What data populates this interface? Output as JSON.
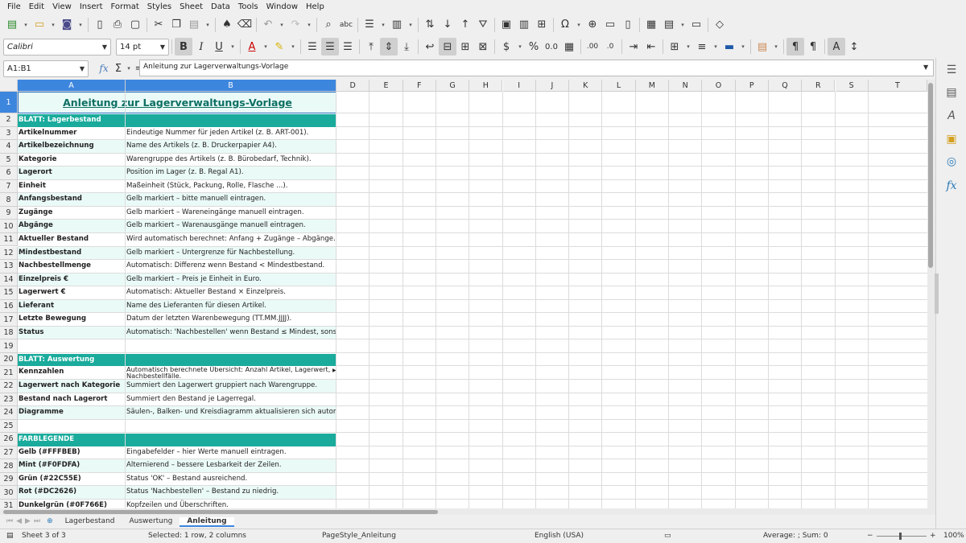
{
  "menu": [
    "File",
    "Edit",
    "View",
    "Insert",
    "Format",
    "Styles",
    "Sheet",
    "Data",
    "Tools",
    "Window",
    "Help"
  ],
  "toolbar": {
    "font_name": "Calibri",
    "font_size": "14 pt"
  },
  "formula_bar": {
    "name_box": "A1:B1",
    "fx_symbol": "fx",
    "sum_symbol": "Σ",
    "equals_symbol": "=",
    "content": "Anleitung zur Lagerverwaltungs-Vorlage"
  },
  "columns": [
    "A",
    "B",
    "C",
    "D",
    "E",
    "F",
    "G",
    "H",
    "I",
    "J",
    "K",
    "L",
    "M",
    "N",
    "O",
    "P",
    "Q",
    "R",
    "S",
    "T"
  ],
  "rows": [
    {
      "n": "1",
      "type": "title",
      "a": "Anleitung zur Lagerverwaltungs-Vorlage",
      "b": ""
    },
    {
      "n": "2",
      "type": "hdr",
      "a": "BLATT: Lagerbestand",
      "b": ""
    },
    {
      "n": "3",
      "type": "white",
      "a": "Artikelnummer",
      "b": "Eindeutige Nummer für jeden Artikel (z. B. ART-001)."
    },
    {
      "n": "4",
      "type": "mint",
      "a": "Artikelbezeichnung",
      "b": "Name des Artikels (z. B. Druckerpapier A4)."
    },
    {
      "n": "5",
      "type": "white",
      "a": "Kategorie",
      "b": "Warengruppe des Artikels (z. B. Bürobedarf, Technik)."
    },
    {
      "n": "6",
      "type": "mint",
      "a": "Lagerort",
      "b": "Position im Lager (z. B. Regal A1)."
    },
    {
      "n": "7",
      "type": "white",
      "a": "Einheit",
      "b": "Maßeinheit (Stück, Packung, Rolle, Flasche ...)."
    },
    {
      "n": "8",
      "type": "mint",
      "a": "Anfangsbestand",
      "b": "Gelb markiert – bitte manuell eintragen."
    },
    {
      "n": "9",
      "type": "white",
      "a": "Zugänge",
      "b": "Gelb markiert – Wareneingänge manuell eintragen."
    },
    {
      "n": "10",
      "type": "mint",
      "a": "Abgänge",
      "b": "Gelb markiert – Warenausgänge manuell eintragen."
    },
    {
      "n": "11",
      "type": "white",
      "a": "Aktueller Bestand",
      "b": "Wird automatisch berechnet: Anfang + Zugänge – Abgänge."
    },
    {
      "n": "12",
      "type": "mint",
      "a": "Mindestbestand",
      "b": "Gelb markiert – Untergrenze für Nachbestellung."
    },
    {
      "n": "13",
      "type": "white",
      "a": "Nachbestellmenge",
      "b": "Automatisch: Differenz wenn Bestand < Mindestbestand."
    },
    {
      "n": "14",
      "type": "mint",
      "a": "Einzelpreis €",
      "b": "Gelb markiert – Preis je Einheit in Euro."
    },
    {
      "n": "15",
      "type": "white",
      "a": "Lagerwert €",
      "b": "Automatisch: Aktueller Bestand × Einzelpreis."
    },
    {
      "n": "16",
      "type": "mint",
      "a": "Lieferant",
      "b": "Name des Lieferanten für diesen Artikel."
    },
    {
      "n": "17",
      "type": "white",
      "a": "Letzte Bewegung",
      "b": "Datum der letzten Warenbewegung (TT.MM.JJJJ)."
    },
    {
      "n": "18",
      "type": "mint",
      "a": "Status",
      "b": "Automatisch: 'Nachbestellen' wenn Bestand ≤ Mindest, sonst 'OK'."
    },
    {
      "n": "19",
      "type": "white",
      "a": "",
      "b": ""
    },
    {
      "n": "20",
      "type": "hdr",
      "a": "BLATT: Auswertung",
      "b": ""
    },
    {
      "n": "21",
      "type": "white",
      "a": "Kennzahlen",
      "b": "Automatisch berechnete Übersicht: Anzahl Artikel, Lagerwert, Nachbestellfälle."
    },
    {
      "n": "22",
      "type": "mint",
      "a": "Lagerwert nach Kategorie",
      "b": "Summiert den Lagerwert gruppiert nach Warengruppe."
    },
    {
      "n": "23",
      "type": "white",
      "a": "Bestand nach Lagerort",
      "b": "Summiert den Bestand je Lagerregal."
    },
    {
      "n": "24",
      "type": "mint",
      "a": "Diagramme",
      "b": "Säulen-, Balken- und Kreisdiagramm aktualisieren sich automatisch."
    },
    {
      "n": "25",
      "type": "white",
      "a": "",
      "b": ""
    },
    {
      "n": "26",
      "type": "hdr",
      "a": "FARBLEGENDE",
      "b": ""
    },
    {
      "n": "27",
      "type": "white",
      "a": "Gelb (#FFFBEB)",
      "b": "Eingabefelder – hier Werte manuell eintragen."
    },
    {
      "n": "28",
      "type": "mint",
      "a": "Mint (#F0FDFA)",
      "b": "Alternierend – bessere Lesbarkeit der Zeilen."
    },
    {
      "n": "29",
      "type": "white",
      "a": "Grün (#22C55E)",
      "b": "Status 'OK' – Bestand ausreichend."
    },
    {
      "n": "30",
      "type": "mint",
      "a": "Rot (#DC2626)",
      "b": "Status 'Nachbestellen' – Bestand zu niedrig."
    },
    {
      "n": "31",
      "type": "white",
      "a": "Dunkelgrün (#0F766E)",
      "b": "Kopfzeilen und Überschriften."
    }
  ],
  "sheet_tabs": [
    "Lagerbestand",
    "Auswertung",
    "Anleitung"
  ],
  "active_tab": "Anleitung",
  "status": {
    "sheet": "Sheet 3 of 3",
    "selection": "Selected: 1 row, 2 columns",
    "page_style": "PageStyle_Anleitung",
    "language": "English (USA)",
    "stats": "Average: ; Sum: 0",
    "zoom": "100%"
  },
  "colors": {
    "header_teal": "#1aab9c",
    "mint": "#eafaf7",
    "selection_blue": "#3d86de",
    "title_text": "#0d6f63"
  }
}
